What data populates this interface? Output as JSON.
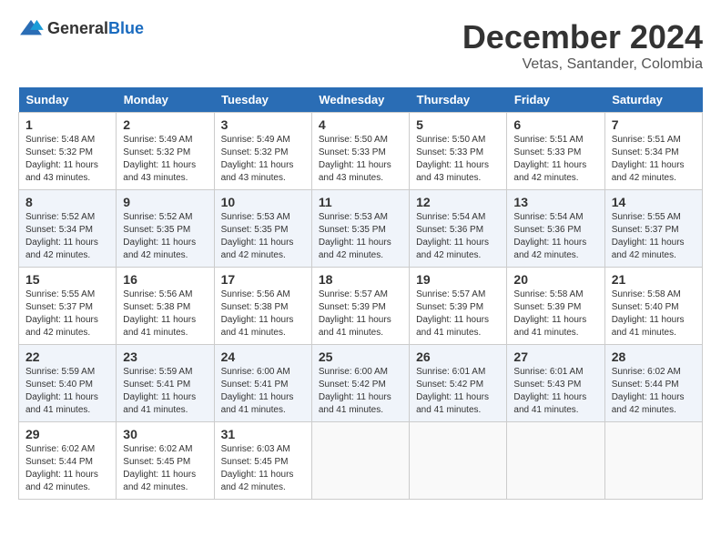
{
  "logo": {
    "text_general": "General",
    "text_blue": "Blue"
  },
  "title": {
    "month": "December 2024",
    "location": "Vetas, Santander, Colombia"
  },
  "calendar": {
    "headers": [
      "Sunday",
      "Monday",
      "Tuesday",
      "Wednesday",
      "Thursday",
      "Friday",
      "Saturday"
    ],
    "weeks": [
      [
        {
          "day": "",
          "empty": true
        },
        {
          "day": "",
          "empty": true
        },
        {
          "day": "",
          "empty": true
        },
        {
          "day": "",
          "empty": true
        },
        {
          "day": "",
          "empty": true
        },
        {
          "day": "",
          "empty": true
        },
        {
          "day": "",
          "empty": true
        }
      ],
      [
        {
          "day": "1",
          "sunrise": "Sunrise: 5:48 AM",
          "sunset": "Sunset: 5:32 PM",
          "daylight": "Daylight: 11 hours and 43 minutes."
        },
        {
          "day": "2",
          "sunrise": "Sunrise: 5:49 AM",
          "sunset": "Sunset: 5:32 PM",
          "daylight": "Daylight: 11 hours and 43 minutes."
        },
        {
          "day": "3",
          "sunrise": "Sunrise: 5:49 AM",
          "sunset": "Sunset: 5:32 PM",
          "daylight": "Daylight: 11 hours and 43 minutes."
        },
        {
          "day": "4",
          "sunrise": "Sunrise: 5:50 AM",
          "sunset": "Sunset: 5:33 PM",
          "daylight": "Daylight: 11 hours and 43 minutes."
        },
        {
          "day": "5",
          "sunrise": "Sunrise: 5:50 AM",
          "sunset": "Sunset: 5:33 PM",
          "daylight": "Daylight: 11 hours and 43 minutes."
        },
        {
          "day": "6",
          "sunrise": "Sunrise: 5:51 AM",
          "sunset": "Sunset: 5:33 PM",
          "daylight": "Daylight: 11 hours and 42 minutes."
        },
        {
          "day": "7",
          "sunrise": "Sunrise: 5:51 AM",
          "sunset": "Sunset: 5:34 PM",
          "daylight": "Daylight: 11 hours and 42 minutes."
        }
      ],
      [
        {
          "day": "8",
          "sunrise": "Sunrise: 5:52 AM",
          "sunset": "Sunset: 5:34 PM",
          "daylight": "Daylight: 11 hours and 42 minutes."
        },
        {
          "day": "9",
          "sunrise": "Sunrise: 5:52 AM",
          "sunset": "Sunset: 5:35 PM",
          "daylight": "Daylight: 11 hours and 42 minutes."
        },
        {
          "day": "10",
          "sunrise": "Sunrise: 5:53 AM",
          "sunset": "Sunset: 5:35 PM",
          "daylight": "Daylight: 11 hours and 42 minutes."
        },
        {
          "day": "11",
          "sunrise": "Sunrise: 5:53 AM",
          "sunset": "Sunset: 5:35 PM",
          "daylight": "Daylight: 11 hours and 42 minutes."
        },
        {
          "day": "12",
          "sunrise": "Sunrise: 5:54 AM",
          "sunset": "Sunset: 5:36 PM",
          "daylight": "Daylight: 11 hours and 42 minutes."
        },
        {
          "day": "13",
          "sunrise": "Sunrise: 5:54 AM",
          "sunset": "Sunset: 5:36 PM",
          "daylight": "Daylight: 11 hours and 42 minutes."
        },
        {
          "day": "14",
          "sunrise": "Sunrise: 5:55 AM",
          "sunset": "Sunset: 5:37 PM",
          "daylight": "Daylight: 11 hours and 42 minutes."
        }
      ],
      [
        {
          "day": "15",
          "sunrise": "Sunrise: 5:55 AM",
          "sunset": "Sunset: 5:37 PM",
          "daylight": "Daylight: 11 hours and 42 minutes."
        },
        {
          "day": "16",
          "sunrise": "Sunrise: 5:56 AM",
          "sunset": "Sunset: 5:38 PM",
          "daylight": "Daylight: 11 hours and 41 minutes."
        },
        {
          "day": "17",
          "sunrise": "Sunrise: 5:56 AM",
          "sunset": "Sunset: 5:38 PM",
          "daylight": "Daylight: 11 hours and 41 minutes."
        },
        {
          "day": "18",
          "sunrise": "Sunrise: 5:57 AM",
          "sunset": "Sunset: 5:39 PM",
          "daylight": "Daylight: 11 hours and 41 minutes."
        },
        {
          "day": "19",
          "sunrise": "Sunrise: 5:57 AM",
          "sunset": "Sunset: 5:39 PM",
          "daylight": "Daylight: 11 hours and 41 minutes."
        },
        {
          "day": "20",
          "sunrise": "Sunrise: 5:58 AM",
          "sunset": "Sunset: 5:39 PM",
          "daylight": "Daylight: 11 hours and 41 minutes."
        },
        {
          "day": "21",
          "sunrise": "Sunrise: 5:58 AM",
          "sunset": "Sunset: 5:40 PM",
          "daylight": "Daylight: 11 hours and 41 minutes."
        }
      ],
      [
        {
          "day": "22",
          "sunrise": "Sunrise: 5:59 AM",
          "sunset": "Sunset: 5:40 PM",
          "daylight": "Daylight: 11 hours and 41 minutes."
        },
        {
          "day": "23",
          "sunrise": "Sunrise: 5:59 AM",
          "sunset": "Sunset: 5:41 PM",
          "daylight": "Daylight: 11 hours and 41 minutes."
        },
        {
          "day": "24",
          "sunrise": "Sunrise: 6:00 AM",
          "sunset": "Sunset: 5:41 PM",
          "daylight": "Daylight: 11 hours and 41 minutes."
        },
        {
          "day": "25",
          "sunrise": "Sunrise: 6:00 AM",
          "sunset": "Sunset: 5:42 PM",
          "daylight": "Daylight: 11 hours and 41 minutes."
        },
        {
          "day": "26",
          "sunrise": "Sunrise: 6:01 AM",
          "sunset": "Sunset: 5:42 PM",
          "daylight": "Daylight: 11 hours and 41 minutes."
        },
        {
          "day": "27",
          "sunrise": "Sunrise: 6:01 AM",
          "sunset": "Sunset: 5:43 PM",
          "daylight": "Daylight: 11 hours and 41 minutes."
        },
        {
          "day": "28",
          "sunrise": "Sunrise: 6:02 AM",
          "sunset": "Sunset: 5:44 PM",
          "daylight": "Daylight: 11 hours and 42 minutes."
        }
      ],
      [
        {
          "day": "29",
          "sunrise": "Sunrise: 6:02 AM",
          "sunset": "Sunset: 5:44 PM",
          "daylight": "Daylight: 11 hours and 42 minutes."
        },
        {
          "day": "30",
          "sunrise": "Sunrise: 6:02 AM",
          "sunset": "Sunset: 5:45 PM",
          "daylight": "Daylight: 11 hours and 42 minutes."
        },
        {
          "day": "31",
          "sunrise": "Sunrise: 6:03 AM",
          "sunset": "Sunset: 5:45 PM",
          "daylight": "Daylight: 11 hours and 42 minutes."
        },
        {
          "day": "",
          "empty": true
        },
        {
          "day": "",
          "empty": true
        },
        {
          "day": "",
          "empty": true
        },
        {
          "day": "",
          "empty": true
        }
      ]
    ]
  }
}
